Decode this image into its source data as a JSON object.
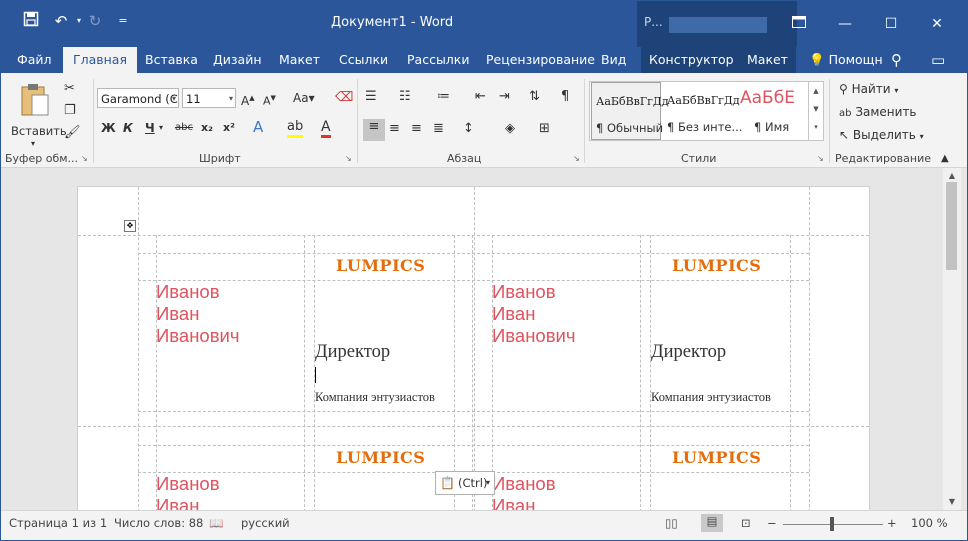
{
  "window": {
    "title": "Документ1  -  Word",
    "account": "Р..."
  },
  "tabs": [
    "Файл",
    "Главная",
    "Вставка",
    "Дизайн",
    "Макет",
    "Ссылки",
    "Рассылки",
    "Рецензирование",
    "Вид",
    "Конструктор",
    "Макет"
  ],
  "help": "Помощн",
  "ribbon": {
    "clipboard": {
      "paste": "Вставить",
      "label": "Буфер обм..."
    },
    "font": {
      "name": "Garamond (С",
      "size": "11",
      "label": "Шрифт",
      "bold": "Ж",
      "italic": "К",
      "underline": "Ч",
      "strike": "abc",
      "sub": "x₂",
      "sup": "x²",
      "case": "Aa"
    },
    "paragraph": {
      "label": "Абзац"
    },
    "styles": {
      "label": "Стили",
      "items": [
        {
          "preview": "АаБбВвГгДд",
          "name": "¶ Обычный"
        },
        {
          "preview": "АаБбВвГгДд",
          "name": "¶ Без инте..."
        },
        {
          "preview": "АаБбЕ",
          "name": "¶ Имя"
        }
      ]
    },
    "editing": {
      "label": "Редактирование",
      "find": "Найти",
      "replace": "Заменить",
      "select": "Выделить"
    }
  },
  "document": {
    "cards": [
      {
        "logo": "LUMPICS",
        "name1": "Иванов",
        "name2": "Иван",
        "name3": "Иванович",
        "job": "Директор",
        "company": "Компания энтузиастов"
      },
      {
        "logo": "LUMPICS",
        "name1": "Иванов",
        "name2": "Иван",
        "name3": "Иванович",
        "job": "Директор",
        "company": "Компания энтузиастов"
      },
      {
        "logo": "LUMPICS",
        "name1": "Иванов",
        "name2": "Иван"
      },
      {
        "logo": "LUMPICS",
        "name1": "Иванов",
        "name2": "Иван"
      }
    ],
    "paste_tip": "(Ctrl)"
  },
  "status": {
    "page": "Страница 1 из 1",
    "words": "Число слов: 88",
    "lang": "русский",
    "zoom": "100 %"
  }
}
